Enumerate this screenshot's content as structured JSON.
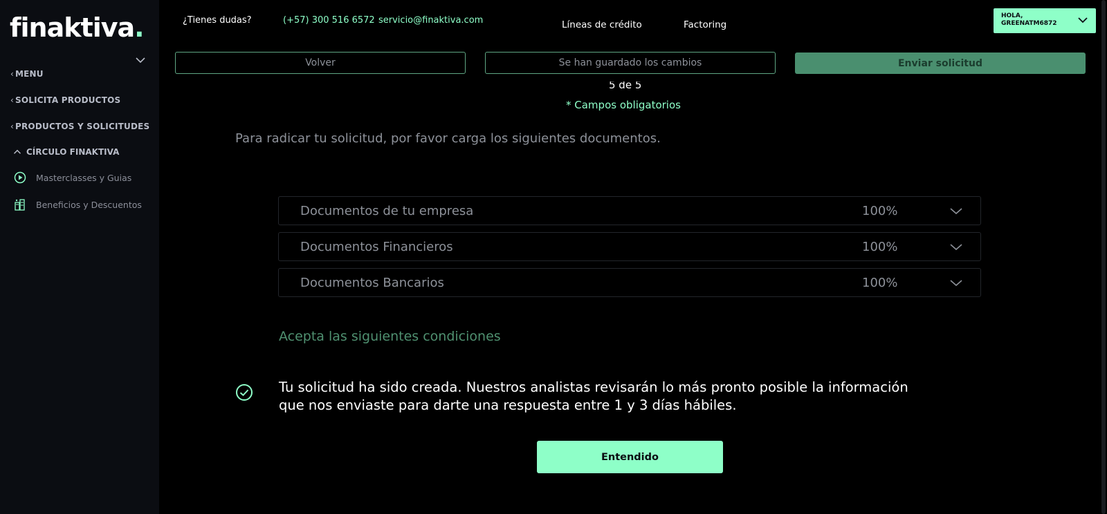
{
  "brand": {
    "name": "finaktiva",
    "dot": ".",
    "accent": "#8effc8"
  },
  "sidebar": {
    "menu": "MENU",
    "solicita": "SOLICITA PRODUCTOS",
    "productos": "PRODUCTOS Y SOLICITUDES",
    "circulo": "CÍRCULO FINAKTIVA",
    "sub_items": [
      {
        "label": "Masterclasses y Guias",
        "icon": "play-circle-icon"
      },
      {
        "label": "Beneficios y Descuentos",
        "icon": "building-percent-icon"
      }
    ]
  },
  "topbar": {
    "question": "¿Tienes dudas?",
    "phone": "(+57) 300 516 6572",
    "email": "servicio@finaktiva.com",
    "nav": [
      "Líneas de crédito",
      "Factoring"
    ],
    "user_line1": "HOLA,",
    "user_line2": "GREENATM6872"
  },
  "actions": {
    "back": "Volver",
    "saved": "Se han guardado los cambios",
    "send": "Enviar solicitud"
  },
  "form": {
    "step_partial": "5 de 5",
    "required_note": "* Campos obligatorios",
    "instructions": "Para radicar tu solicitud, por favor carga los siguientes documentos.",
    "documents": [
      {
        "label": "Documentos de tu empresa",
        "progress": "100%"
      },
      {
        "label": "Documentos Financieros",
        "progress": "100%"
      },
      {
        "label": "Documentos Bancarios",
        "progress": "100%"
      }
    ],
    "conditions": "Acepta las siguientes condiciones"
  },
  "modal": {
    "message": "Tu solicitud ha sido creada. Nuestros analistas revisarán lo más pronto posible la información que nos enviaste para darte una respuesta entre 1 y 3 días hábiles.",
    "ok": "Entendido"
  }
}
